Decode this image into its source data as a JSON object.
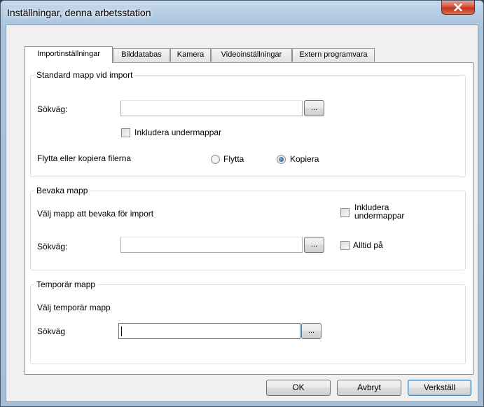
{
  "window": {
    "title": "Inställningar, denna arbetsstation",
    "close_glyph": "x"
  },
  "tabs": [
    {
      "label": "Importinställningar",
      "active": true
    },
    {
      "label": "Bilddatabas",
      "active": false
    },
    {
      "label": "Kamera",
      "active": false
    },
    {
      "label": "Videoinställningar",
      "active": false
    },
    {
      "label": "Extern programvara",
      "active": false
    }
  ],
  "standard_import": {
    "title": "Standard mapp vid import",
    "path_label": "Sökväg:",
    "path_value": "",
    "browse_label": "...",
    "include_subfolders_label": "Inkludera undermappar",
    "include_subfolders_checked": false,
    "move_or_copy_label": "Flytta eller kopiera filerna",
    "move_label": "Flytta",
    "copy_label": "Kopiera",
    "selected": "Kopiera"
  },
  "watch_folder": {
    "title": "Bevaka mapp",
    "description": "Välj mapp att bevaka för import",
    "include_subfolders_label": "Inkludera undermappar",
    "include_subfolders_checked": false,
    "path_label": "Sökväg:",
    "path_value": "",
    "browse_label": "...",
    "always_on_label": "Alltid på",
    "always_on_checked": false
  },
  "temp_folder": {
    "title": "Temporär mapp",
    "description": "Välj temporär mapp",
    "path_label": "Sökväg",
    "path_value": "",
    "browse_label": "..."
  },
  "buttons": {
    "ok": "OK",
    "cancel": "Avbryt",
    "apply": "Verkställ"
  }
}
